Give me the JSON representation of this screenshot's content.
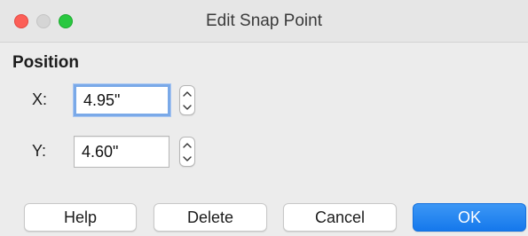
{
  "window": {
    "title": "Edit Snap Point",
    "controls": [
      "close",
      "minimize",
      "zoom"
    ]
  },
  "position": {
    "heading": "Position",
    "x": {
      "label": "X:",
      "value": "4.95\""
    },
    "y": {
      "label": "Y:",
      "value": "4.60\""
    }
  },
  "buttons": {
    "help": "Help",
    "delete": "Delete",
    "cancel": "Cancel",
    "ok": "OK"
  },
  "colors": {
    "close": "#fc5f57",
    "minimize": "#d5d5d5",
    "zoom": "#29c840",
    "focus_ring": "#7aa9e8",
    "default_button": "#1a85f0"
  },
  "icons": {
    "stepper_up": "chevron-up-icon",
    "stepper_down": "chevron-down-icon"
  }
}
